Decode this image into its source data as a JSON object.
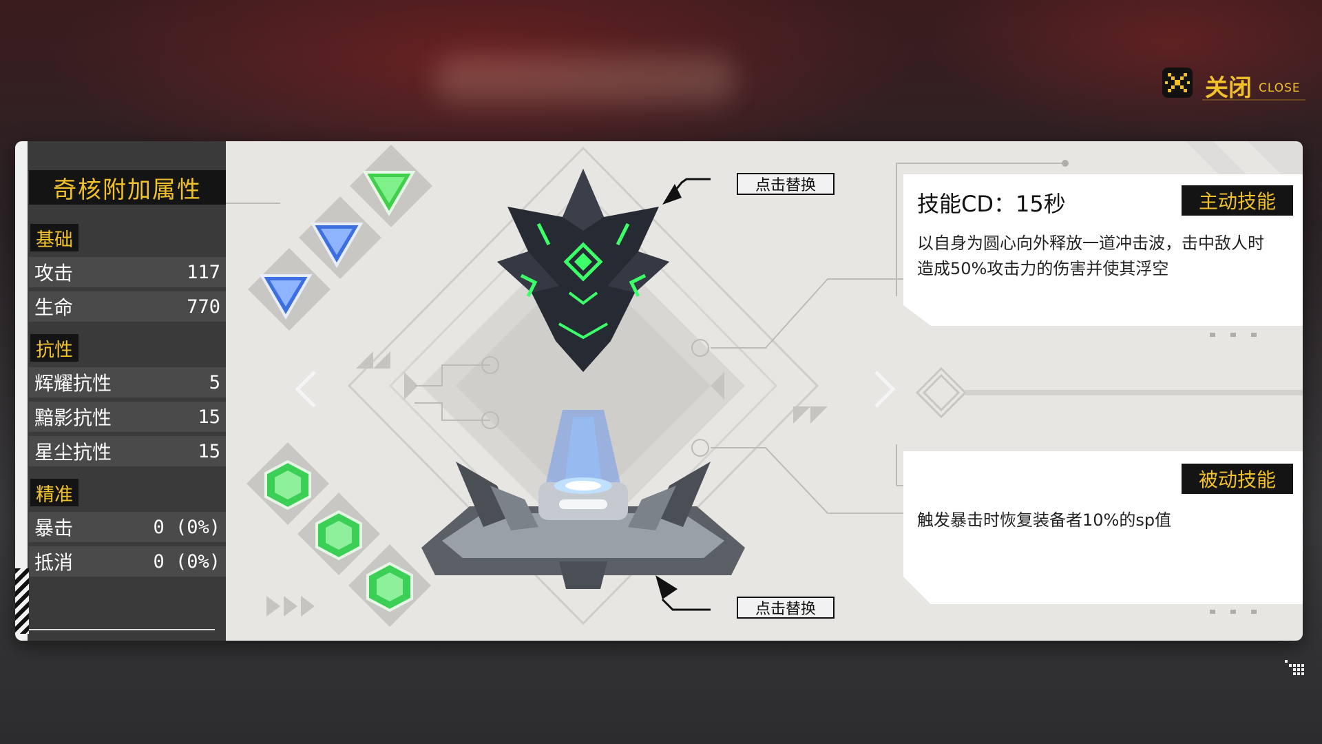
{
  "close": {
    "label": "关闭",
    "sub": "CLOSE",
    "icon": "close-x-icon"
  },
  "stats": {
    "title": "奇核附加属性",
    "sections": {
      "basic": "基础",
      "resist": "抗性",
      "precision": "精准"
    },
    "rows": [
      {
        "label": "攻击",
        "value": "117"
      },
      {
        "label": "生命",
        "value": "770"
      },
      {
        "label": "辉耀抗性",
        "value": "5"
      },
      {
        "label": "黯影抗性",
        "value": "15"
      },
      {
        "label": "星尘抗性",
        "value": "15"
      },
      {
        "label": "暴击",
        "value": "0 (0%)"
      },
      {
        "label": "抵消",
        "value": "0 (0%)"
      }
    ]
  },
  "callouts": {
    "top": "点击替换",
    "bottom": "点击替换"
  },
  "active_skill": {
    "cd": "技能CD：15秒",
    "tag": "主动技能",
    "desc_line1": "以自身为圆心向外释放一道冲击波，击中敌人时",
    "desc_line2": "造成50%攻击力的伤害并使其浮空"
  },
  "passive_skill": {
    "tag": "被动技能",
    "desc": "触发暴击时恢复装备者10%的sp值"
  },
  "icons": {
    "gems_top": [
      "green-triangle-gem-icon",
      "blue-triangle-gem-icon",
      "blue-triangle-gem-icon"
    ],
    "gems_bottom": [
      "green-hexagon-gem-icon",
      "green-hexagon-gem-icon",
      "green-hexagon-gem-icon"
    ],
    "core": "dark-crystal-core-icon",
    "pedestal": "core-pedestal-icon"
  },
  "colors": {
    "accent": "#f0c12b",
    "panel": "#e8e6e3",
    "dark": "#141414",
    "glow": "#3cff6a"
  }
}
